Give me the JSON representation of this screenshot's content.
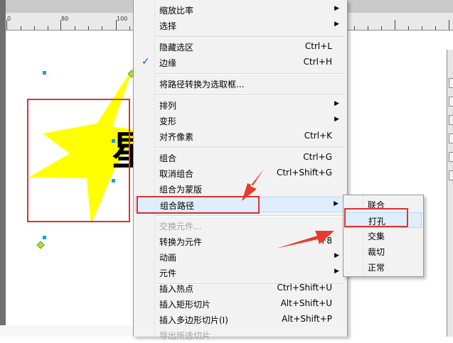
{
  "ruler": {
    "labels": [
      "0",
      "80",
      "100"
    ]
  },
  "context_menu": {
    "items": [
      {
        "label": "缩放比率",
        "shortcut": "",
        "submenu": true
      },
      {
        "label": "选择",
        "shortcut": "",
        "submenu": true
      },
      {
        "label": "隐藏选区",
        "shortcut": "Ctrl+L"
      },
      {
        "label": "边缘",
        "shortcut": "Ctrl+H",
        "checked": true
      },
      {
        "label": "将路径转换为选取框...",
        "shortcut": ""
      },
      {
        "label": "排列",
        "shortcut": "",
        "submenu": true
      },
      {
        "label": "变形",
        "shortcut": "",
        "submenu": true
      },
      {
        "label": "对齐像素",
        "shortcut": "Ctrl+K"
      },
      {
        "label": "组合",
        "shortcut": "Ctrl+G"
      },
      {
        "label": "取消组合",
        "shortcut": "Ctrl+Shift+G"
      },
      {
        "label": "组合为蒙版",
        "shortcut": ""
      },
      {
        "label": "组合路径",
        "shortcut": "",
        "submenu": true,
        "highlighted": true
      },
      {
        "label": "交换元件...",
        "shortcut": "",
        "disabled": true
      },
      {
        "label": "转换为元件",
        "shortcut": "F8"
      },
      {
        "label": "动画",
        "shortcut": "",
        "submenu": true
      },
      {
        "label": "元件",
        "shortcut": "",
        "submenu": true
      },
      {
        "label": "插入热点",
        "shortcut": "Ctrl+Shift+U"
      },
      {
        "label": "插入矩形切片",
        "shortcut": "Alt+Shift+U"
      },
      {
        "label": "插入多边形切片(I)",
        "shortcut": "Alt+Shift+P"
      },
      {
        "label": "导出所选切片",
        "shortcut": "",
        "disabled": true
      }
    ],
    "check_mark": "✓",
    "arrow_glyph": "▶"
  },
  "sub_menu": {
    "items": [
      {
        "label": "联合"
      },
      {
        "label": "打孔",
        "highlighted": true
      },
      {
        "label": "交集"
      },
      {
        "label": "裁切"
      },
      {
        "label": "正常"
      }
    ]
  },
  "canvas": {
    "glyph": "星",
    "colors": {
      "star": "#ffff00",
      "annotation": "#e0322e",
      "handle": "#1d9be9"
    }
  },
  "icons": [
    "check-icon",
    "submenu-arrow-icon",
    "annotation-arrow-icon"
  ]
}
